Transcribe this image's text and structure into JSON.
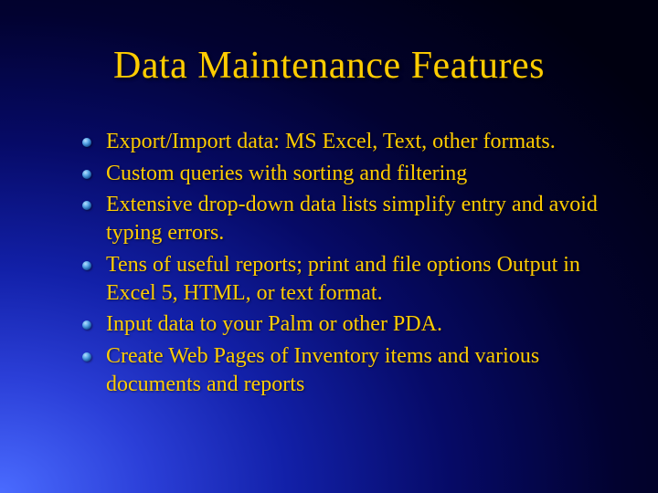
{
  "title": "Data Maintenance Features",
  "bullets": [
    "Export/Import data: MS Excel, Text, other formats.",
    "Custom queries with sorting and filtering",
    "Extensive drop-down data lists simplify entry and avoid typing errors.",
    "Tens of useful reports; print and file options Output in Excel 5, HTML, or text format.",
    "Input data to your Palm or other PDA.",
    "Create Web Pages of Inventory items and various documents and reports"
  ]
}
